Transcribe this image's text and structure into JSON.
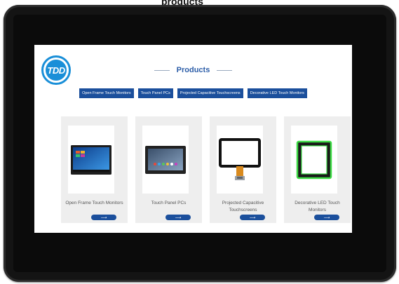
{
  "top_text": "products",
  "logo": {
    "text": "TDD",
    "color": "#1a8fd8"
  },
  "page": {
    "title": "Products"
  },
  "categories": [
    {
      "label": "Open Frame Touch Monitors"
    },
    {
      "label": "Touch Panel PCs"
    },
    {
      "label": "Projected Capacitive Touchscreens"
    },
    {
      "label": "Decorative LED Touch Monitors"
    }
  ],
  "products": [
    {
      "name": "Open Frame Touch Monitors",
      "icon": "monitor-icon",
      "button_glyph": "⟶"
    },
    {
      "name": "Touch Panel PCs",
      "icon": "tablet-icon",
      "button_glyph": "⟶"
    },
    {
      "name": "Projected Capacitive Touchscreens",
      "icon": "touchscreen-icon",
      "button_glyph": "⟶"
    },
    {
      "name": "Decorative LED Touch Monitors",
      "icon": "led-frame-icon",
      "button_glyph": "⟶"
    }
  ],
  "colors": {
    "accent": "#1b4f9c",
    "title": "#2c5da8",
    "card_bg": "#eeeeee",
    "bezel": "#141414",
    "led_glow": "#3ddc45"
  }
}
